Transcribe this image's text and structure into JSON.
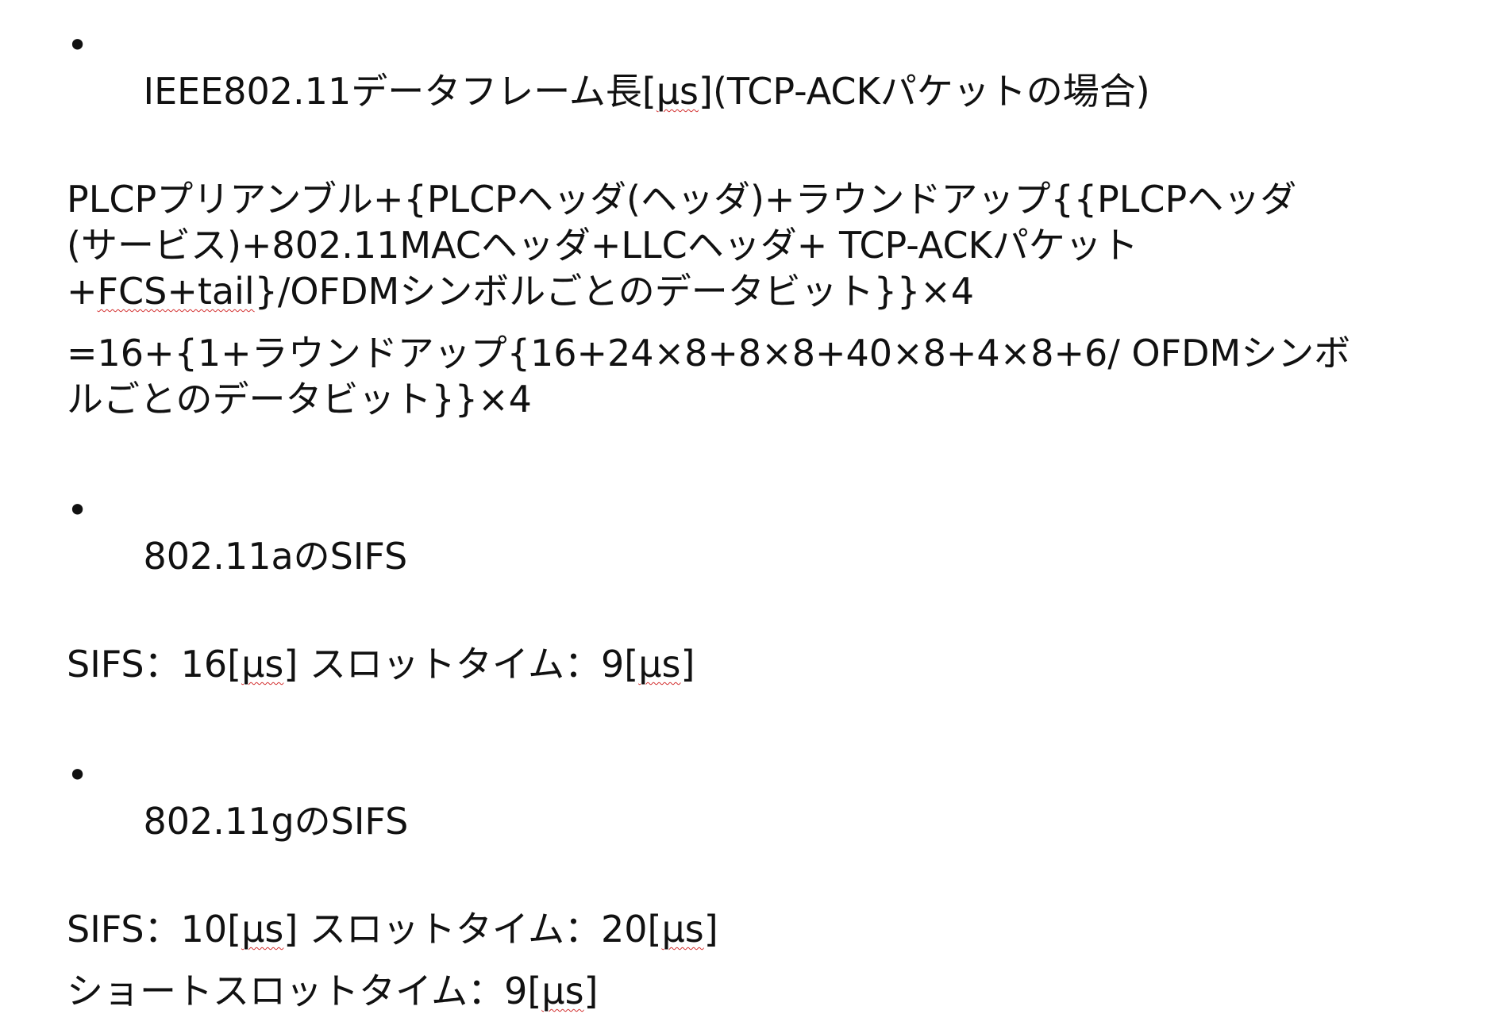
{
  "sections": [
    {
      "bullet": "•",
      "heading": {
        "before": "IEEE802.11データフレーム長[",
        "mark": "μs",
        "after": "](TCP-ACKパケットの場合)"
      },
      "para1": [
        "PLCPプリアンブル+{PLCPヘッダ(ヘッダ)+ラウンドアップ{{PLCPヘッダ",
        "(サービス)+802.11MACヘッダ+LLCヘッダ+ TCP-ACKパケット"
      ],
      "para1_last": {
        "before": "+",
        "mark": "FCS+tail",
        "after": "}/OFDMシンボルごとのデータビット}}×4"
      },
      "para2": [
        "=16+{1+ラウンドアップ{16+24×8+8×8+40×8+4×8+6/ OFDMシンボ",
        "ルごとのデータビット}}×4"
      ]
    },
    {
      "bullet": "•",
      "heading": "802.11aのSIFS",
      "line": {
        "a_before": "SIFS：16[",
        "a_mark": "μs",
        "a_after": "] スロットタイム：9[",
        "b_mark": "μs",
        "b_after": "]"
      }
    },
    {
      "bullet": "•",
      "heading": "802.11gのSIFS",
      "line": {
        "a_before": "SIFS：10[",
        "a_mark": "μs",
        "a_after": "] スロットタイム：20[",
        "b_mark": "μs",
        "b_after": "]"
      },
      "line2": {
        "before": "ショートスロットタイム：9[",
        "mark": "μs",
        "after": "]"
      }
    }
  ],
  "colors": {
    "text": "#111111",
    "spellcheck_underline": "#d32f2f",
    "background": "#ffffff"
  }
}
